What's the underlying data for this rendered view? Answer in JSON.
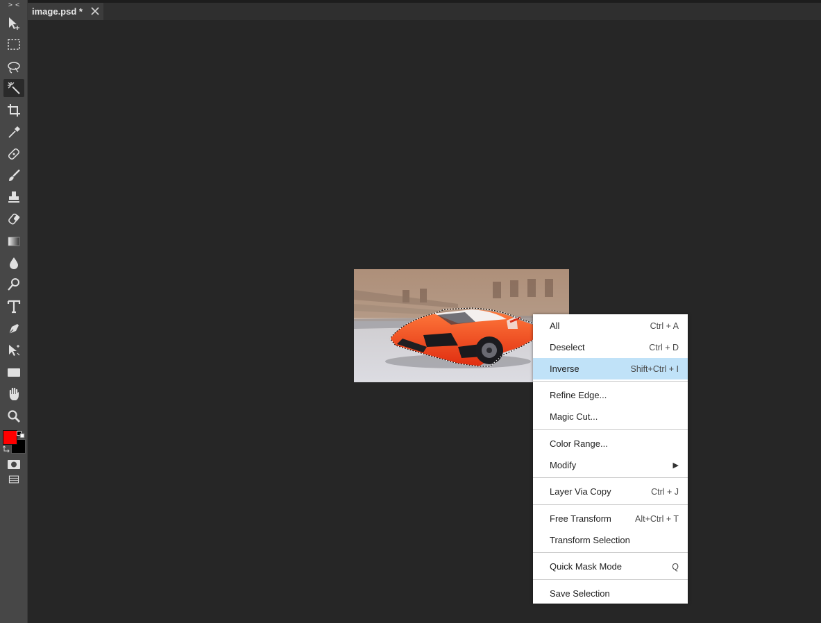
{
  "toolbar": {
    "collapse_label": "> <",
    "tools": [
      {
        "name": "move-icon",
        "active": false
      },
      {
        "name": "marquee-icon",
        "active": false
      },
      {
        "name": "lasso-icon",
        "active": false
      },
      {
        "name": "magic-wand-icon",
        "active": true
      },
      {
        "name": "crop-icon",
        "active": false
      },
      {
        "name": "eyedropper-icon",
        "active": false
      },
      {
        "name": "healing-icon",
        "active": false
      },
      {
        "name": "brush-icon",
        "active": false
      },
      {
        "name": "stamp-icon",
        "active": false
      },
      {
        "name": "eraser-icon",
        "active": false
      },
      {
        "name": "gradient-icon",
        "active": false
      },
      {
        "name": "blur-icon",
        "active": false
      },
      {
        "name": "dodge-icon",
        "active": false
      },
      {
        "name": "text-icon",
        "active": false
      },
      {
        "name": "pen-icon",
        "active": false
      },
      {
        "name": "path-select-icon",
        "active": false
      },
      {
        "name": "rectangle-icon",
        "active": false
      },
      {
        "name": "hand-icon",
        "active": false
      },
      {
        "name": "zoom-icon",
        "active": false
      }
    ],
    "foreground_color": "#ff0000",
    "background_color": "#000000"
  },
  "tab": {
    "title": "image.psd *"
  },
  "context_menu": {
    "items": [
      {
        "label": "All",
        "shortcut": "Ctrl + A",
        "highlighted": false
      },
      {
        "label": "Deselect",
        "shortcut": "Ctrl + D",
        "highlighted": false
      },
      {
        "label": "Inverse",
        "shortcut": "Shift+Ctrl + I",
        "highlighted": true
      },
      {
        "label": "Refine Edge...",
        "shortcut": ""
      },
      {
        "label": "Magic Cut...",
        "shortcut": ""
      },
      {
        "label": "Color Range...",
        "shortcut": ""
      },
      {
        "label": "Modify",
        "shortcut": "▶"
      },
      {
        "label": "Layer Via Copy",
        "shortcut": "Ctrl + J"
      },
      {
        "label": "Free Transform",
        "shortcut": "Alt+Ctrl + T"
      },
      {
        "label": "Transform Selection",
        "shortcut": ""
      },
      {
        "label": "Quick Mask Mode",
        "shortcut": "Q"
      },
      {
        "label": "Save Selection",
        "shortcut": ""
      }
    ]
  },
  "colors": {
    "accent_highlight": "#c0e2f8",
    "workspace": "#262626",
    "toolbar": "#474747"
  }
}
